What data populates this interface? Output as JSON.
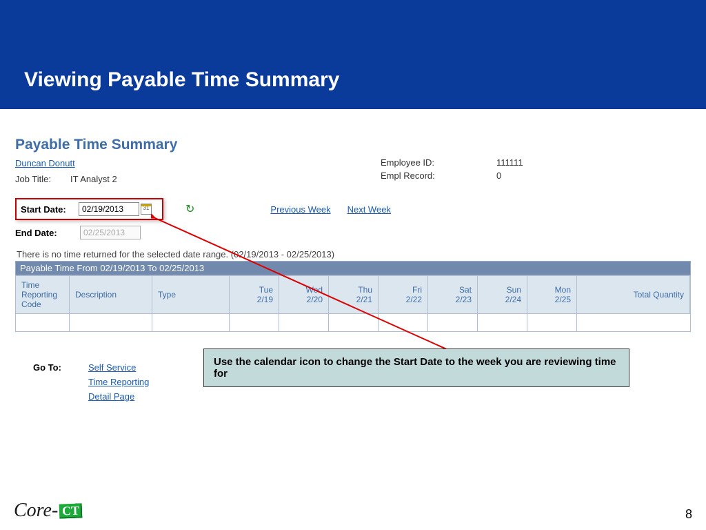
{
  "header": {
    "title": "Viewing Payable Time Summary"
  },
  "page": {
    "title": "Payable Time Summary",
    "user_name": "Duncan Donutt",
    "job_title_label": "Job Title:",
    "job_title_value": "IT Analyst 2",
    "emp_id_label": "Employee ID:",
    "emp_id_value": "111111",
    "empl_record_label": "Empl Record:",
    "empl_record_value": "0"
  },
  "dates": {
    "start_label": "Start Date:",
    "start_value": "02/19/2013",
    "calendar_glyph": "31",
    "end_label": "End Date:",
    "end_value": "02/25/2013",
    "prev_week": "Previous Week",
    "next_week": "Next Week"
  },
  "notice": "There is no time returned for the selected date range. (02/19/2013 - 02/25/2013)",
  "bar_title": "Payable Time From 02/19/2013 To 02/25/2013",
  "cols": {
    "trc1": "Time",
    "trc2": "Reporting",
    "trc3": "Code",
    "desc": "Description",
    "type": "Type",
    "d1a": "Tue",
    "d1b": "2/19",
    "d2a": "Wed",
    "d2b": "2/20",
    "d3a": "Thu",
    "d3b": "2/21",
    "d4a": "Fri",
    "d4b": "2/22",
    "d5a": "Sat",
    "d5b": "2/23",
    "d6a": "Sun",
    "d6b": "2/24",
    "d7a": "Mon",
    "d7b": "2/25",
    "total": "Total Quantity"
  },
  "goto": {
    "label": "Go To:",
    "links": [
      "Self Service",
      "Time Reporting",
      "Detail Page"
    ]
  },
  "callout": "Use the calendar icon to change the Start Date to the week you are reviewing time for",
  "footer": {
    "logo_text": "Core-",
    "logo_badge": "CT",
    "page_number": "8"
  }
}
